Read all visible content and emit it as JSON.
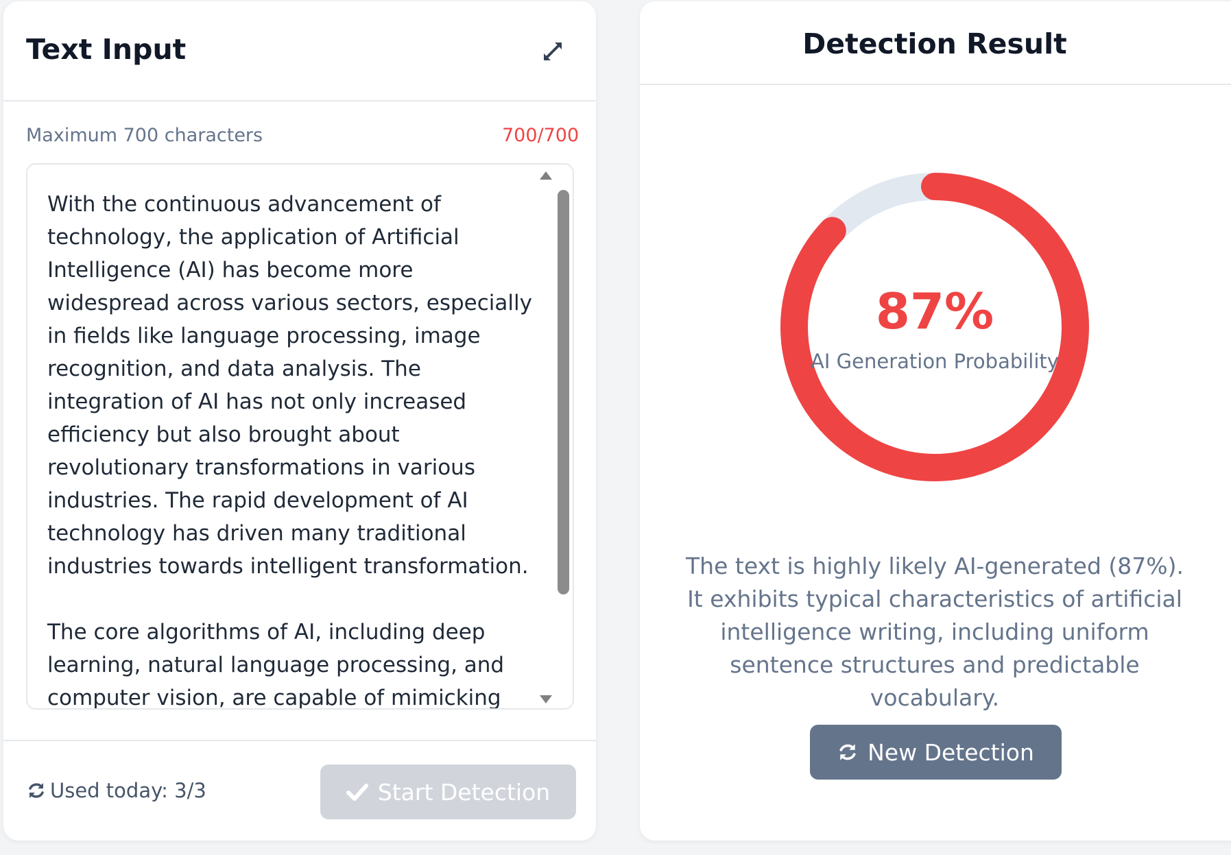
{
  "input_panel": {
    "title": "Text Input",
    "hint": "Maximum 700 characters",
    "counter": "700/700",
    "text": "With the continuous advancement of technology, the application of Artificial Intelligence (AI) has become more widespread across various sectors, especially in fields like language processing, image recognition, and data analysis. The integration of AI has not only increased efficiency but also brought about revolutionary transformations in various industries. The rapid development of AI technology has driven many traditional industries towards intelligent transformation.\n\nThe core algorithms of AI, including deep learning, natural language processing, and computer vision, are capable of mimicking",
    "usage": "Used today: 3/3",
    "start_button": "Start Detection"
  },
  "result_panel": {
    "title": "Detection Result",
    "probability": 0.87,
    "percent_text": "87%",
    "probability_label": "AI Generation Probability",
    "explanation": "The text is highly likely AI-generated (87%). It exhibits typical characteristics of artificial intelligence writing, including uniform sentence structures and predictable vocabulary.",
    "new_button": "New Detection"
  },
  "colors": {
    "accent_red": "#ef4444",
    "track": "#e2e8f0",
    "slate_button": "#64748b",
    "disabled_button": "#d1d5db"
  },
  "icons": {
    "expand": "expand-icon",
    "refresh": "refresh-icon",
    "check": "check-icon"
  }
}
